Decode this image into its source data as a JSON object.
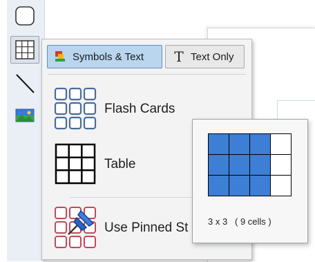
{
  "toolbar": {
    "tools": [
      {
        "icon": "rounded-rectangle-icon",
        "selected": false
      },
      {
        "icon": "grid-icon",
        "selected": true
      },
      {
        "icon": "line-icon",
        "selected": false
      },
      {
        "icon": "image-icon",
        "selected": false
      }
    ]
  },
  "menu": {
    "mode_buttons": {
      "symbols_text": {
        "label": "Symbols & Text",
        "active": true,
        "icon": "symbols-icon"
      },
      "text_only": {
        "label": "Text Only",
        "active": false,
        "icon": "text-t-icon"
      }
    },
    "items": [
      {
        "label": "Flash Cards",
        "icon": "flash-cards-icon"
      },
      {
        "label": "Table",
        "icon": "table-icon"
      },
      {
        "label": "Use Pinned St",
        "icon": "pinned-styles-icon"
      }
    ]
  },
  "grid_picker": {
    "rows": 3,
    "cols": 4,
    "selected_rows": 3,
    "selected_cols": 3,
    "label": "3 x 3   ( 9 cells )"
  },
  "colors": {
    "accent": "#3c7fd4",
    "active_button_bg": "#b9d6ee",
    "flash_card_outline": "#4a6c9a",
    "pinned_outline": "#c2485a"
  }
}
